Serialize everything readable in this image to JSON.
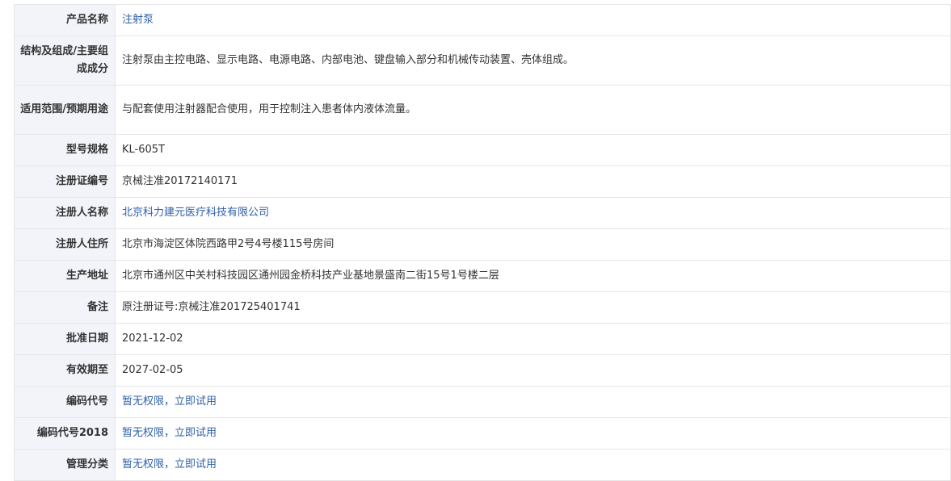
{
  "rows": [
    {
      "label": "产品名称",
      "value": "注射泵",
      "link": true,
      "tall": false
    },
    {
      "label": "结构及组成/主要组成成分",
      "value": "注射泵由主控电路、显示电路、电源电路、内部电池、键盘输入部分和机械传动装置、壳体组成。",
      "link": false,
      "tall": true
    },
    {
      "label": "适用范围/预期用途",
      "value": "与配套使用注射器配合使用，用于控制注入患者体内液体流量。",
      "link": false,
      "tall": true
    },
    {
      "label": "型号规格",
      "value": "KL-605T",
      "link": false,
      "tall": false
    },
    {
      "label": "注册证编号",
      "value": "京械注准20172140171",
      "link": false,
      "tall": false
    },
    {
      "label": "注册人名称",
      "value": "北京科力建元医疗科技有限公司",
      "link": true,
      "tall": false
    },
    {
      "label": "注册人住所",
      "value": "北京市海淀区体院西路甲2号4号楼115号房间",
      "link": false,
      "tall": false
    },
    {
      "label": "生产地址",
      "value": "北京市通州区中关村科技园区通州园金桥科技产业基地景盛南二街15号1号楼二层",
      "link": false,
      "tall": false
    },
    {
      "label": "备注",
      "value": "原注册证号:京械注准201725401741",
      "link": false,
      "tall": false
    },
    {
      "label": "批准日期",
      "value": "2021-12-02",
      "link": false,
      "tall": false
    },
    {
      "label": "有效期至",
      "value": "2027-02-05",
      "link": false,
      "tall": false
    },
    {
      "label": "编码代号",
      "value": "暂无权限，立即试用",
      "link": true,
      "tall": false
    },
    {
      "label": "编码代号2018",
      "value": "暂无权限，立即试用",
      "link": true,
      "tall": false
    },
    {
      "label": "管理分类",
      "value": "暂无权限，立即试用",
      "link": true,
      "tall": false
    }
  ],
  "colors": {
    "label_bg": "#f2f4fa",
    "link": "#2e5fa8",
    "text": "#333333",
    "border": "#e6e6e6"
  }
}
